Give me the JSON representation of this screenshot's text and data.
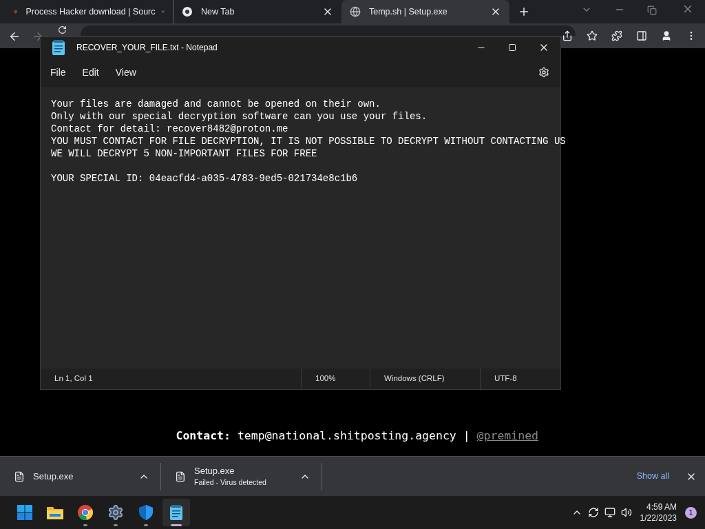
{
  "browser": {
    "tabs": [
      {
        "title": "Process Hacker download | Sourc",
        "selected": false
      },
      {
        "title": "New Tab",
        "selected": false
      },
      {
        "title": "Temp.sh | Setup.exe",
        "selected": true
      }
    ]
  },
  "notepad": {
    "title": "RECOVER_YOUR_FILE.txt - Notepad",
    "menu": [
      "File",
      "Edit",
      "View"
    ],
    "lines": [
      "Your files are damaged and cannot be opened on their own.",
      "Only with our special decryption software can you use your files.",
      "Contact for detail: recover8482@proton.me",
      "YOU MUST CONTACT FOR FILE DECRYPTION, IT IS NOT POSSIBLE TO DECRYPT WITHOUT CONTACTING US",
      "WE WILL DECRYPT 5 NON-IMPORTANT FILES FOR FREE"
    ],
    "id_line": "YOUR SPECIAL ID: 04eacfd4-a035-4783-9ed5-021734e8c1b6",
    "status": [
      "Ln 1, Col 1",
      "100%",
      "Windows (CRLF)",
      "UTF-8"
    ]
  },
  "contact": {
    "label": "Contact:",
    "email": "temp@national.shitposting.agency",
    "separator": "|",
    "handle": "@premined"
  },
  "downloads": [
    {
      "name": "Setup.exe"
    },
    {
      "name": "Setup.exe",
      "status": "Failed - Virus detected"
    }
  ],
  "show_all": "Show all",
  "taskbar": {
    "apps": [
      {
        "running": false,
        "active": false
      },
      {
        "running": false,
        "active": false
      },
      {
        "running": true,
        "active": false
      },
      {
        "running": true,
        "active": false
      },
      {
        "running": true,
        "active": false
      },
      {
        "running": true,
        "active": true
      }
    ],
    "time": "4:59 AM",
    "date": "1/22/2023",
    "notifications": "1"
  }
}
